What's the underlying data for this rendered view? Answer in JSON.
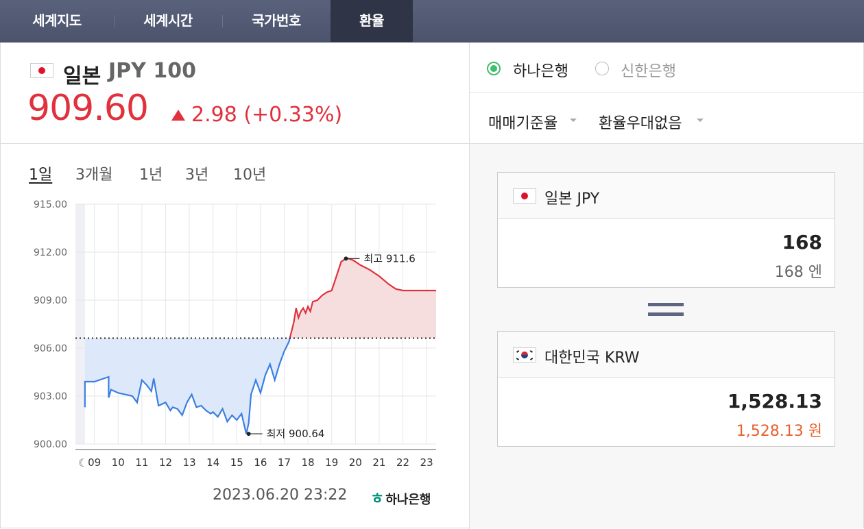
{
  "tabs": [
    {
      "label": "세계지도"
    },
    {
      "label": "세계시간"
    },
    {
      "label": "국가번호"
    },
    {
      "label": "환율",
      "active": true
    }
  ],
  "currency": {
    "flag_icon": "japan-flag-icon",
    "name": "일본",
    "code": "JPY 100",
    "price": "909.60",
    "change": "2.98 (+0.33%)",
    "direction": "up"
  },
  "periods": [
    "1일",
    "3개월",
    "1년",
    "3년",
    "10년"
  ],
  "active_period": "1일",
  "colors": {
    "up": "#e0313d",
    "down_line": "#3a7fe0",
    "accent_green": "#3fbf6c",
    "tab_bg": "#4f5770"
  },
  "chart_data": {
    "type": "line",
    "ylim": [
      900,
      915
    ],
    "yticks": [
      "915.00",
      "912.00",
      "909.00",
      "906.00",
      "903.00",
      "900.00"
    ],
    "xticks": [
      "09",
      "10",
      "11",
      "12",
      "13",
      "14",
      "15",
      "16",
      "17",
      "18",
      "19",
      "20",
      "21",
      "22",
      "23"
    ],
    "xlim": [
      8.2,
      23.4
    ],
    "baseline": 906.62,
    "night_icon": "moon-icon",
    "x": [
      8.6,
      8.6,
      9.0,
      9.6,
      9.6,
      9.7,
      10.0,
      10.3,
      10.6,
      10.8,
      11.0,
      11.2,
      11.4,
      11.5,
      11.7,
      12.0,
      12.2,
      12.3,
      12.5,
      12.7,
      12.9,
      13.1,
      13.3,
      13.5,
      13.7,
      13.9,
      14.0,
      14.2,
      14.4,
      14.6,
      14.8,
      15.0,
      15.2,
      15.4,
      15.5,
      15.6,
      15.8,
      16.0,
      16.2,
      16.4,
      16.6,
      16.8,
      17.0,
      17.2,
      17.4,
      17.5,
      17.6,
      17.7,
      17.8,
      17.9,
      18.0,
      18.1,
      18.2,
      18.4,
      18.6,
      18.8,
      19.0,
      19.2,
      19.4,
      19.6,
      19.7,
      19.9,
      20.2,
      20.6,
      21.0,
      21.4,
      21.7,
      22.0,
      22.2,
      22.5,
      22.8,
      23.1,
      23.4
    ],
    "y": [
      902.3,
      903.9,
      903.9,
      904.2,
      902.9,
      903.4,
      903.2,
      903.1,
      903.0,
      902.6,
      904.0,
      903.7,
      903.3,
      904.1,
      902.4,
      902.6,
      902.1,
      902.3,
      902.2,
      901.8,
      902.6,
      903.1,
      902.3,
      902.4,
      902.1,
      901.9,
      902.0,
      901.7,
      902.2,
      901.4,
      901.8,
      901.5,
      901.9,
      900.64,
      901.3,
      903.1,
      904.0,
      903.2,
      904.3,
      905.0,
      904.0,
      905.0,
      905.8,
      906.4,
      907.6,
      908.5,
      907.9,
      908.3,
      908.5,
      908.2,
      908.6,
      908.3,
      908.9,
      909.0,
      909.3,
      909.5,
      909.6,
      910.5,
      911.4,
      911.6,
      911.6,
      911.5,
      911.2,
      910.9,
      910.5,
      910.0,
      909.7,
      909.6,
      909.6,
      909.6,
      909.6,
      909.6,
      909.6
    ],
    "annotations": [
      {
        "label": "최고 911.6",
        "x": 19.6,
        "y": 911.6
      },
      {
        "label": "최저 900.64",
        "x": 15.5,
        "y": 900.64
      }
    ]
  },
  "footer": {
    "timestamp": "2023.06.20 23:22",
    "bank_logo": "하나은행"
  },
  "banks": [
    {
      "label": "하나은행",
      "selected": true
    },
    {
      "label": "신한은행",
      "selected": false
    }
  ],
  "dropdowns": [
    {
      "label": "매매기준율"
    },
    {
      "label": "환율우대없음"
    }
  ],
  "converter": {
    "from": {
      "flag_icon": "japan-flag-icon",
      "title": "일본 JPY",
      "value": "168",
      "sub": "168 엔"
    },
    "to": {
      "flag_icon": "korea-flag-icon",
      "title": "대한민국 KRW",
      "value": "1,528.13",
      "sub": "1,528.13 원"
    },
    "equals_icon": "equals-icon"
  }
}
